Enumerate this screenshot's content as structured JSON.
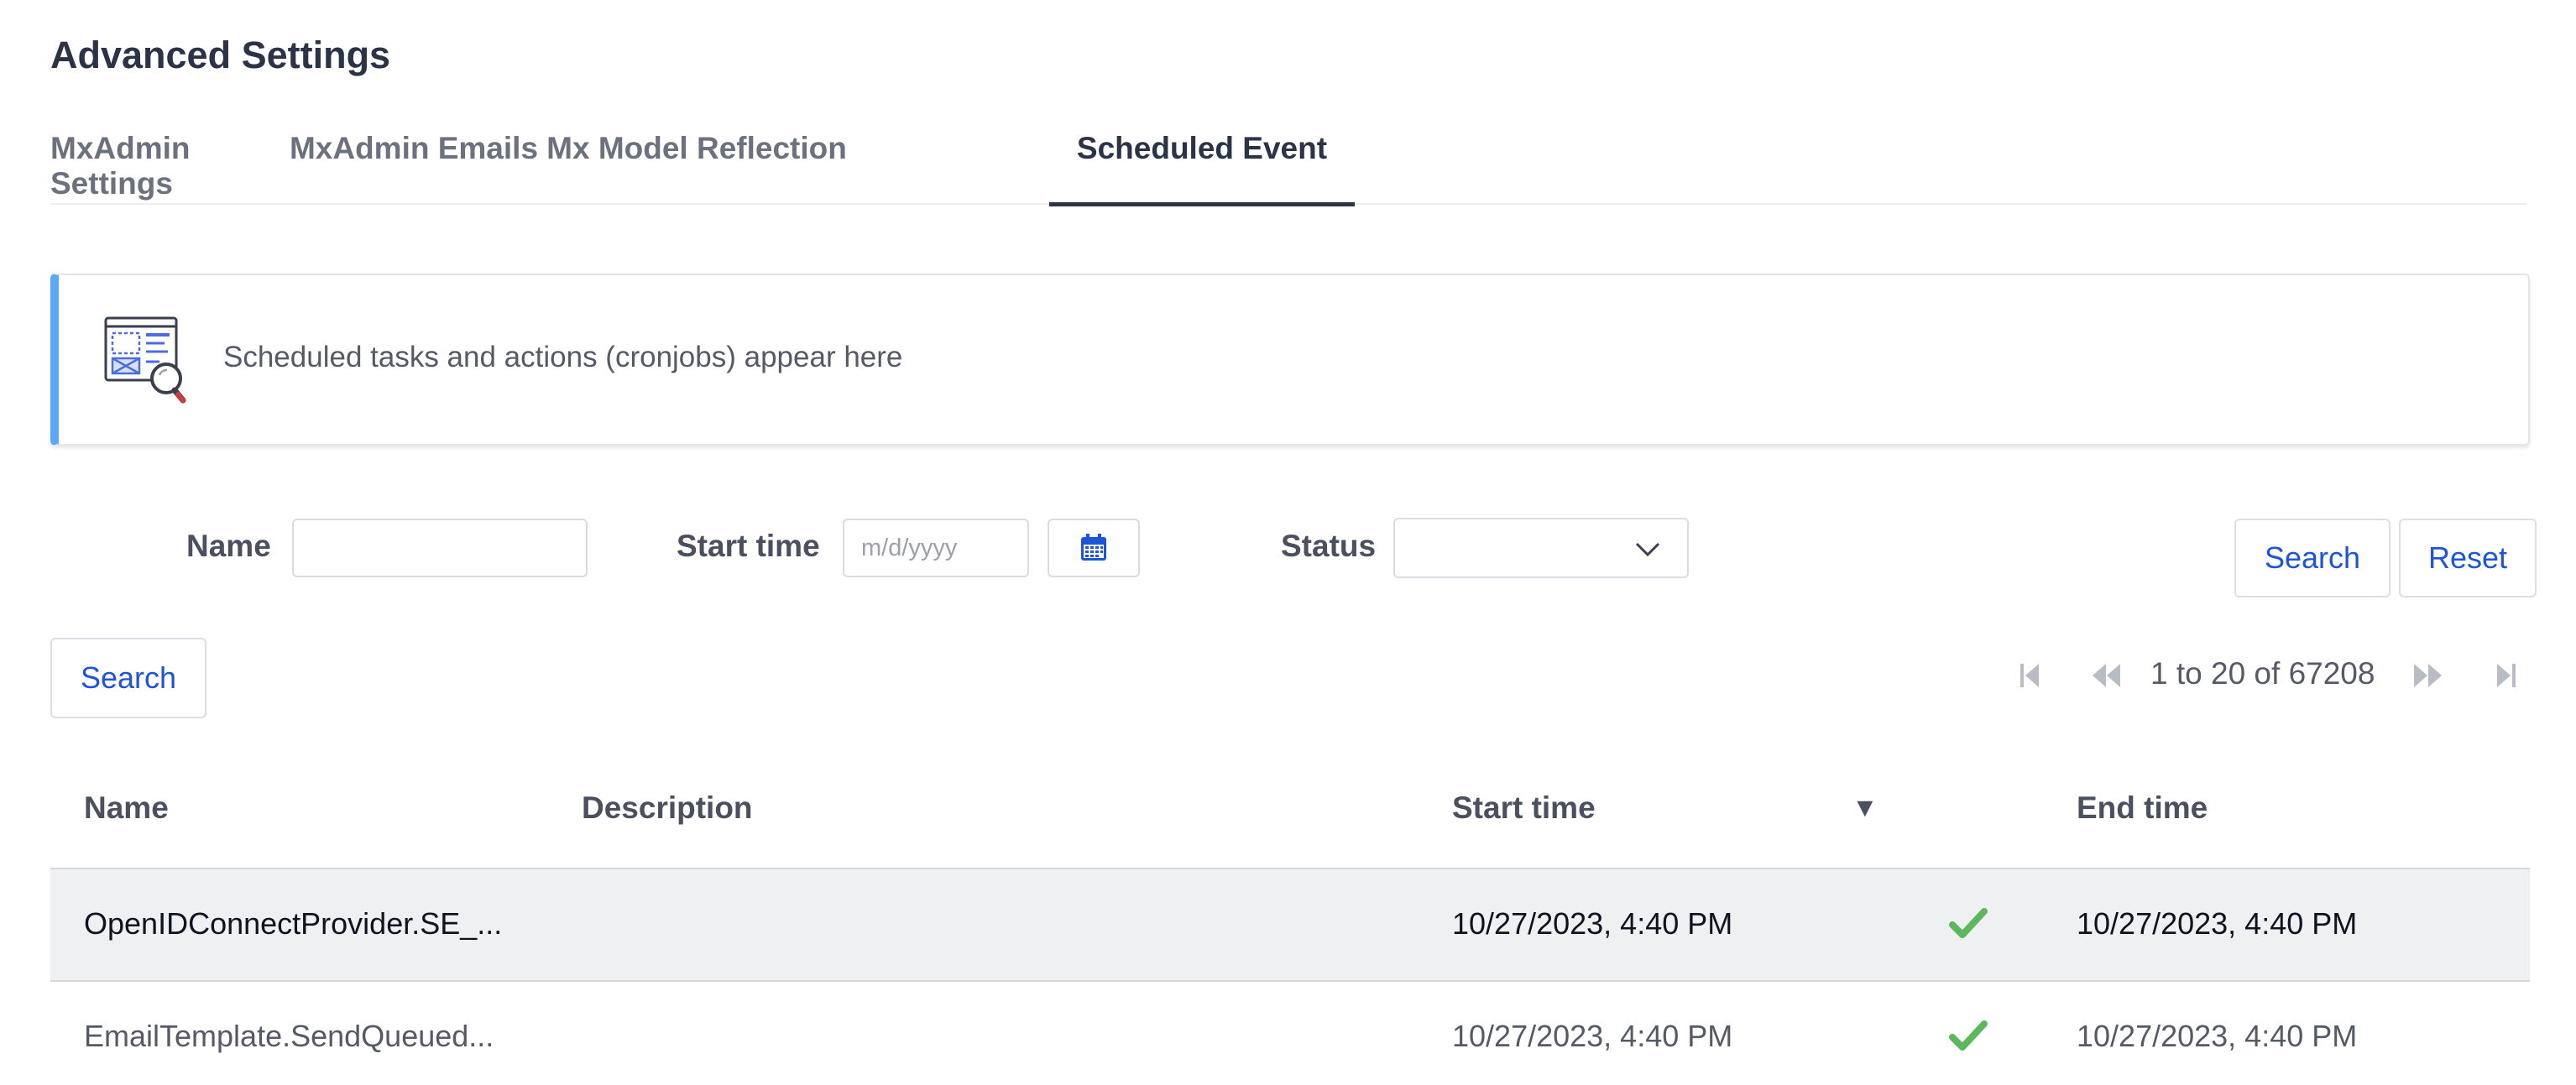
{
  "page": {
    "title": "Advanced Settings"
  },
  "tabs": [
    {
      "label": "MxAdmin Settings",
      "active": false
    },
    {
      "label": "MxAdmin Emails",
      "active": false
    },
    {
      "label": "Mx Model Reflection",
      "active": false
    },
    {
      "label": "Scheduled Event",
      "active": true
    }
  ],
  "banner": {
    "text": "Scheduled tasks and actions (cronjobs) appear here",
    "icon": "report-search-icon",
    "accent_color": "#5aa8f6"
  },
  "filters": {
    "name_label": "Name",
    "name_value": "",
    "start_time_label": "Start time",
    "start_time_placeholder": "m/d/yyyy",
    "status_label": "Status",
    "status_value": "",
    "search_label": "Search",
    "reset_label": "Reset"
  },
  "toolbar": {
    "search_label": "Search"
  },
  "pagination": {
    "text": "1 to 20 of 67208"
  },
  "table": {
    "columns": {
      "name": "Name",
      "description": "Description",
      "start_time": "Start time",
      "end_time": "End time"
    },
    "rows": [
      {
        "name": "OpenIDConnectProvider.SE_...",
        "description": "",
        "start_time": "10/27/2023, 4:40 PM",
        "status": "success-check-icon",
        "end_time": "10/27/2023, 4:40 PM",
        "selected": true
      },
      {
        "name": "EmailTemplate.SendQueued...",
        "description": "",
        "start_time": "10/27/2023, 4:40 PM",
        "status": "success-check-icon",
        "end_time": "10/27/2023, 4:40 PM",
        "selected": false
      }
    ]
  },
  "colors": {
    "primary": "#1d54d8",
    "success": "#5cb85c",
    "text": "#2b3346"
  }
}
